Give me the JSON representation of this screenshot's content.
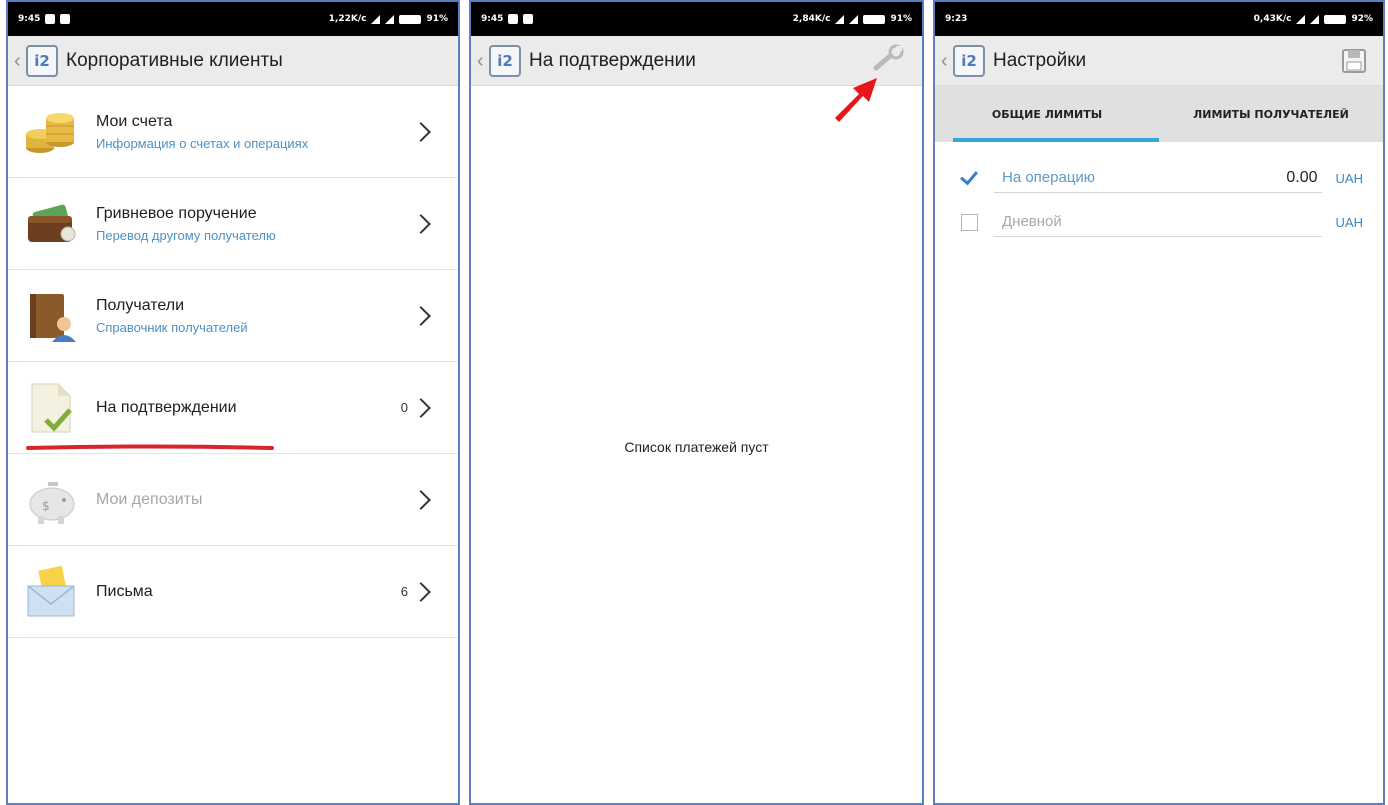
{
  "screen1": {
    "status": {
      "time": "9:45",
      "speed": "1,22K/c",
      "battery": "91%"
    },
    "title": "Корпоративные клиенты",
    "items": [
      {
        "title": "Мои счета",
        "subtitle": "Информация о счетах и операциях",
        "count": ""
      },
      {
        "title": "Гривневое поручение",
        "subtitle": "Перевод другому получателю",
        "count": ""
      },
      {
        "title": "Получатели",
        "subtitle": "Справочник получателей",
        "count": ""
      },
      {
        "title": "На подтверждении",
        "subtitle": "",
        "count": "0"
      },
      {
        "title": "Мои депозиты",
        "subtitle": "",
        "count": ""
      },
      {
        "title": "Письма",
        "subtitle": "",
        "count": "6"
      }
    ]
  },
  "screen2": {
    "status": {
      "time": "9:45",
      "speed": "2,84K/c",
      "battery": "91%"
    },
    "title": "На подтверждении",
    "empty_text": "Список платежей пуст"
  },
  "screen3": {
    "status": {
      "time": "9:23",
      "speed": "0,43K/c",
      "battery": "92%"
    },
    "title": "Настройки",
    "tabs": [
      {
        "label": "ОБЩИЕ ЛИМИТЫ"
      },
      {
        "label": "ЛИМИТЫ ПОЛУЧАТЕЛЕЙ"
      }
    ],
    "limits": [
      {
        "label": "На операцию",
        "value": "0.00",
        "currency": "UAH",
        "checked": true
      },
      {
        "label": "Дневной",
        "value": "",
        "currency": "UAH",
        "checked": false
      }
    ]
  },
  "logo_text": "i2",
  "colors": {
    "accent": "#36a6d8",
    "link": "#4d91c7",
    "highlight": "#d9232d",
    "arrow": "#e8151b",
    "frame": "#5b7fc4"
  }
}
